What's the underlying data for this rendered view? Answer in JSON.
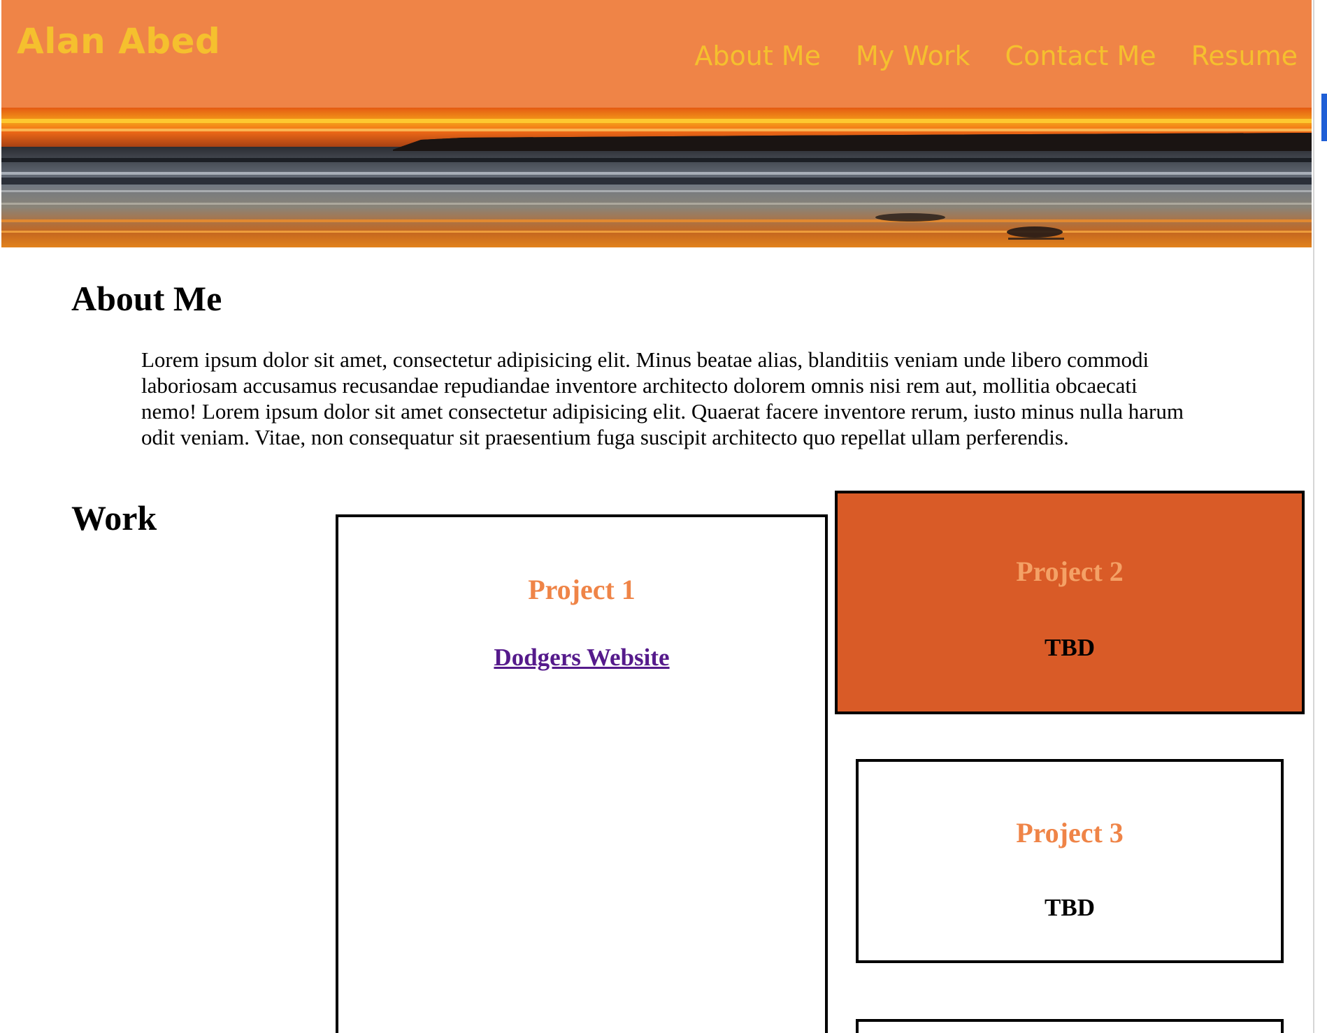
{
  "header": {
    "site_title": "Alan Abed",
    "nav": [
      {
        "label": "About Me"
      },
      {
        "label": "My Work"
      },
      {
        "label": "Contact Me"
      },
      {
        "label": "Resume"
      }
    ],
    "bg_color": "#ef8447",
    "text_color": "#f5c02e"
  },
  "banner": {
    "image": "sunset-beach-banner"
  },
  "about": {
    "heading": "About Me",
    "body": "Lorem ipsum dolor sit amet, consectetur adipisicing elit. Minus beatae alias, blanditiis veniam unde libero commodi laboriosam accusamus recusandae repudiandae inventore architecto dolorem omnis nisi rem aut, mollitia obcaecati nemo! Lorem ipsum dolor sit amet consectetur adipisicing elit. Quaerat facere inventore rerum, iusto minus nulla harum odit veniam. Vitae, non consequatur sit praesentium fuga suscipit architecto quo repellat ullam perferendis."
  },
  "work": {
    "heading": "Work",
    "projects": [
      {
        "title": "Project 1",
        "link_text": "Dodgers Website"
      },
      {
        "title": "Project 2",
        "text": "TBD"
      },
      {
        "title": "Project 3",
        "text": "TBD"
      }
    ],
    "accent_color": "#ef8447",
    "highlight_bg": "#d95b27"
  }
}
